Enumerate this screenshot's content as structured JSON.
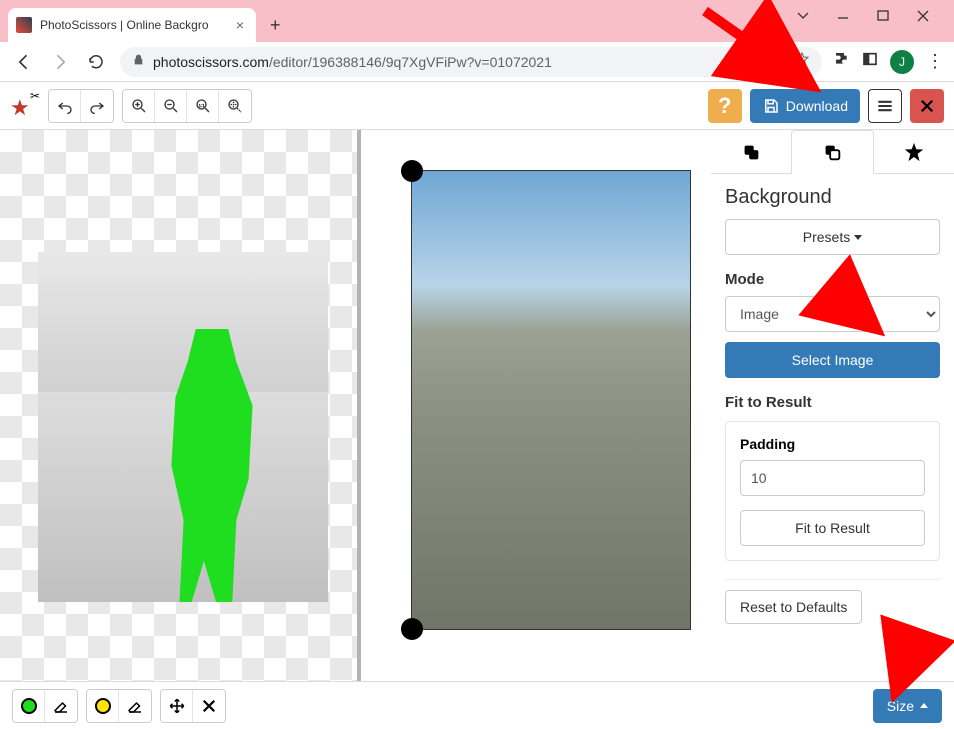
{
  "browser": {
    "tab_title": "PhotoScissors | Online Backgro",
    "url_domain": "photoscissors.com",
    "url_path": "/editor/196388146/9q7XgVFiPw?v=01072021",
    "avatar_letter": "J"
  },
  "toolbar": {
    "download_label": "Download",
    "help_label": "?"
  },
  "sidebar": {
    "title": "Background",
    "presets_label": "Presets",
    "mode_label": "Mode",
    "mode_value": "Image",
    "select_image_label": "Select Image",
    "fit_label": "Fit to Result",
    "padding_label": "Padding",
    "padding_value": "10",
    "fit_button_label": "Fit to Result",
    "reset_label": "Reset to Defaults"
  },
  "bottom": {
    "size_label": "Size"
  }
}
